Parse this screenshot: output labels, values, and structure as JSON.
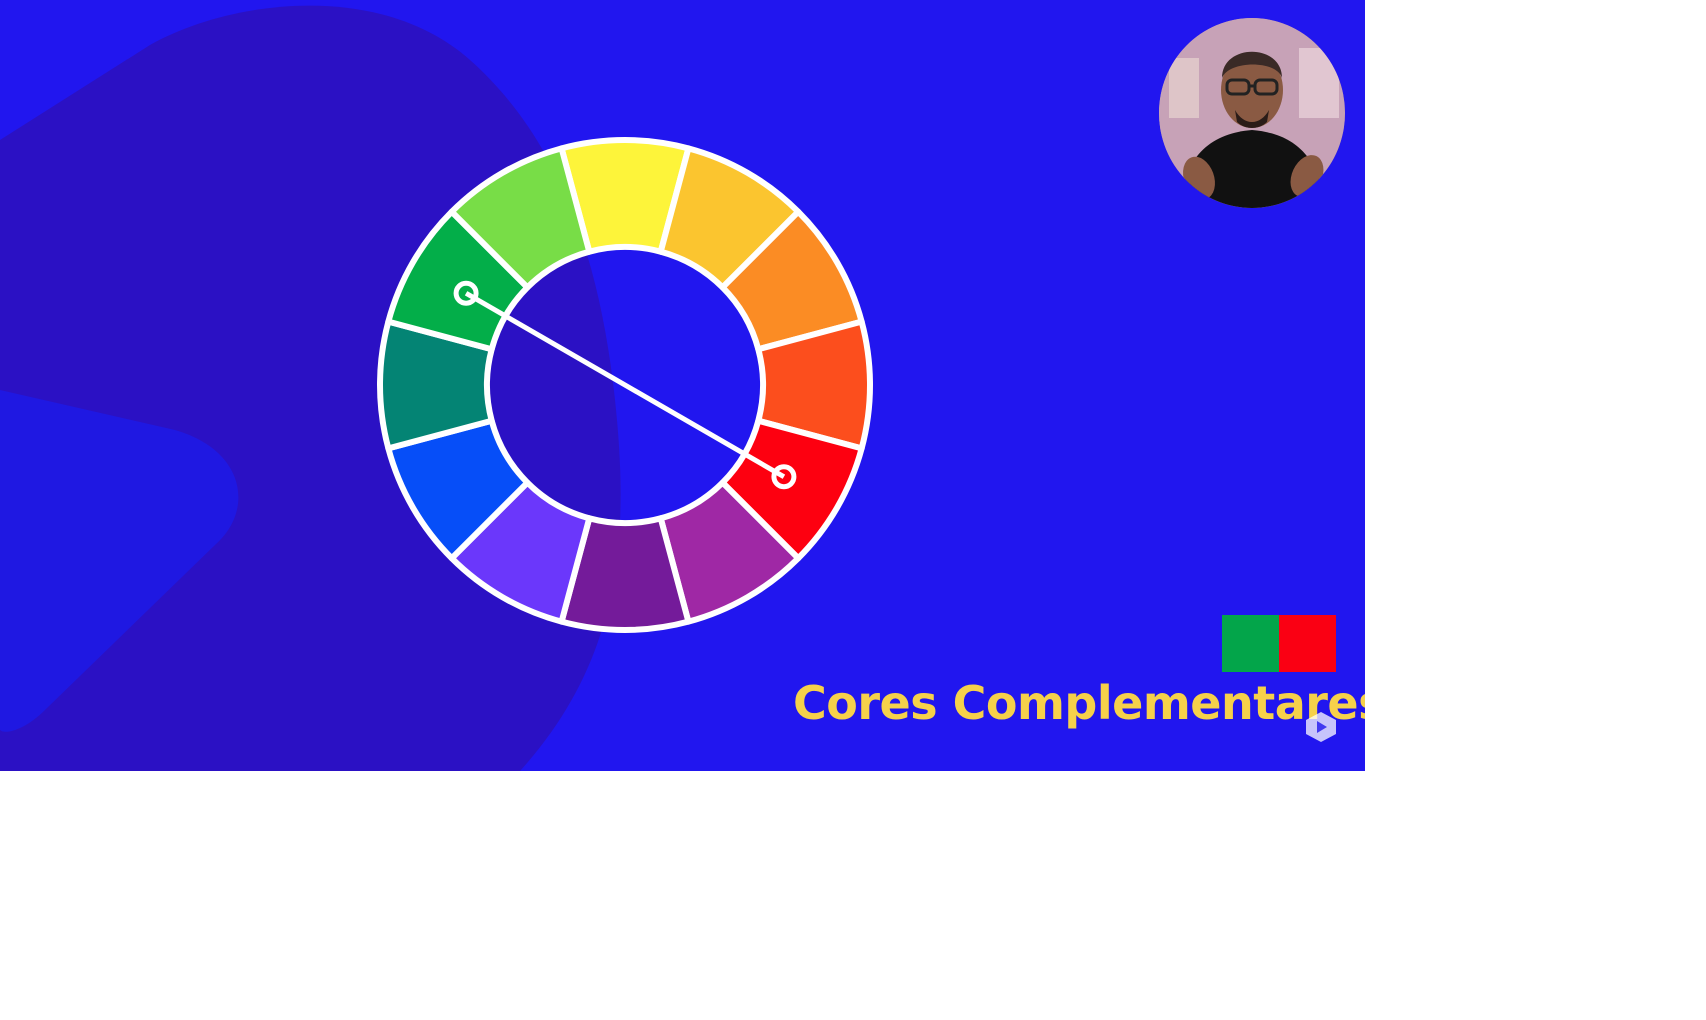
{
  "title": "Cores Complementares",
  "colors": {
    "background": "#2116ef",
    "shape": "#2b11c4",
    "title_text": "#f6d14a",
    "wheel_outline": "#ffffff"
  },
  "color_wheel": {
    "segments": [
      {
        "name": "yellow",
        "color": "#fdf43a"
      },
      {
        "name": "yellow-orange",
        "color": "#fbc52f"
      },
      {
        "name": "orange",
        "color": "#fb8c24"
      },
      {
        "name": "red-orange",
        "color": "#fc4e1d"
      },
      {
        "name": "red",
        "color": "#fd0010"
      },
      {
        "name": "red-violet",
        "color": "#9f28a5"
      },
      {
        "name": "violet",
        "color": "#741b9a"
      },
      {
        "name": "blue-violet",
        "color": "#6b37fb"
      },
      {
        "name": "blue",
        "color": "#064ef8"
      },
      {
        "name": "blue-green",
        "color": "#048474"
      },
      {
        "name": "green",
        "color": "#03ae49"
      },
      {
        "name": "yellow-green",
        "color": "#78dd47"
      }
    ],
    "highlighted_pair": [
      "green",
      "red"
    ]
  },
  "swatches": [
    {
      "name": "green",
      "color": "#03a54a"
    },
    {
      "name": "red",
      "color": "#fa0013"
    }
  ],
  "icons": {
    "watermark": "youtube-logo-icon"
  }
}
